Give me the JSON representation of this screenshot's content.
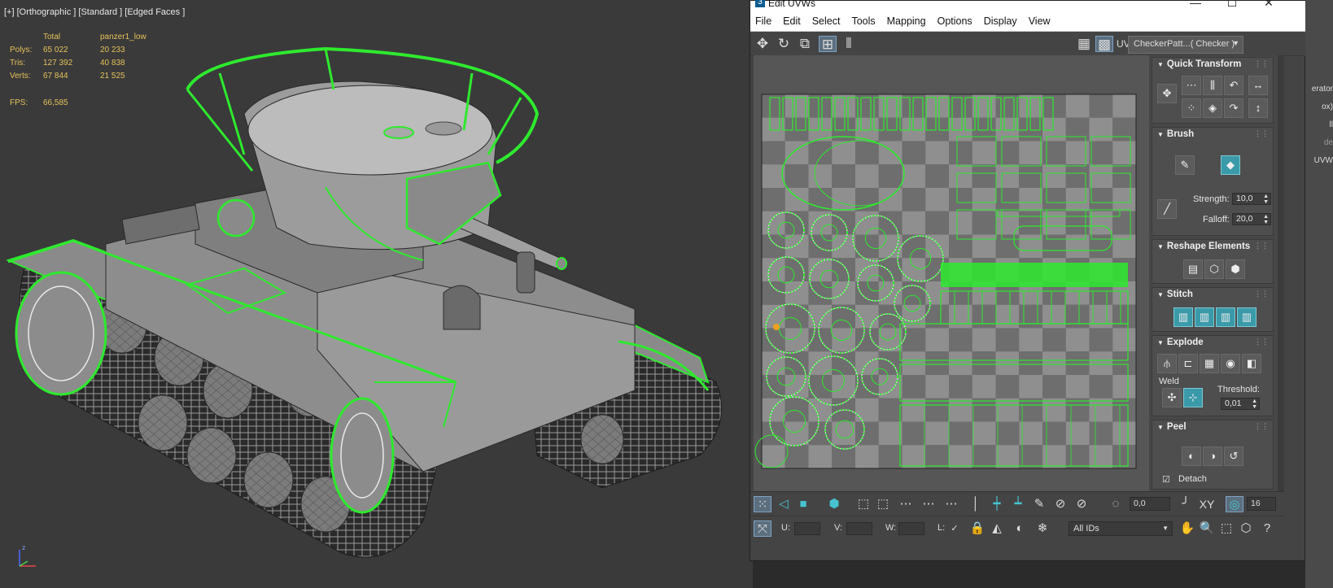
{
  "viewport": {
    "label": "[+] [Orthographic ] [Standard ] [Edged Faces ]",
    "stats": {
      "headers": [
        "",
        "Total",
        "panzer1_low"
      ],
      "rows": [
        [
          "Polys:",
          "65 022",
          "20 233"
        ],
        [
          "Tris:",
          "127 392",
          "40 838"
        ],
        [
          "Verts:",
          "67 844",
          "21 525"
        ]
      ],
      "fps_label": "FPS:",
      "fps_value": "66,585"
    },
    "axis_label": "z"
  },
  "uvw_window": {
    "title": "Edit UVWs",
    "menu": [
      "File",
      "Edit",
      "Select",
      "Tools",
      "Mapping",
      "Options",
      "Display",
      "View"
    ],
    "uv_label": "UV",
    "checker_dropdown": "CheckerPatt...( Checker )",
    "rollouts": {
      "quick_transform": "Quick Transform",
      "brush": "Brush",
      "strength_label": "Strength:",
      "strength_value": "10,0",
      "falloff_label": "Falloff:",
      "falloff_value": "20,0",
      "reshape": "Reshape Elements",
      "stitch": "Stitch",
      "explode": "Explode",
      "weld_label": "Weld",
      "threshold_label": "Threshold:",
      "threshold_value": "0,01",
      "peel": "Peel",
      "detach_label": "Detach"
    },
    "bottom": {
      "xy_label": "XY",
      "spin_value": "0,0",
      "count_value": "16",
      "u_label": "U:",
      "v_label": "V:",
      "w_label": "W:",
      "l_label": "L:",
      "ids_dropdown": "All IDs"
    }
  },
  "command_strip": {
    "texts": [
      "erator",
      "ox)",
      "ll",
      "de",
      "UVW"
    ]
  },
  "colors": {
    "uv_green": "#2eea2e",
    "accent_teal": "#47c2cf",
    "stats_yellow": "#e6c15a"
  }
}
